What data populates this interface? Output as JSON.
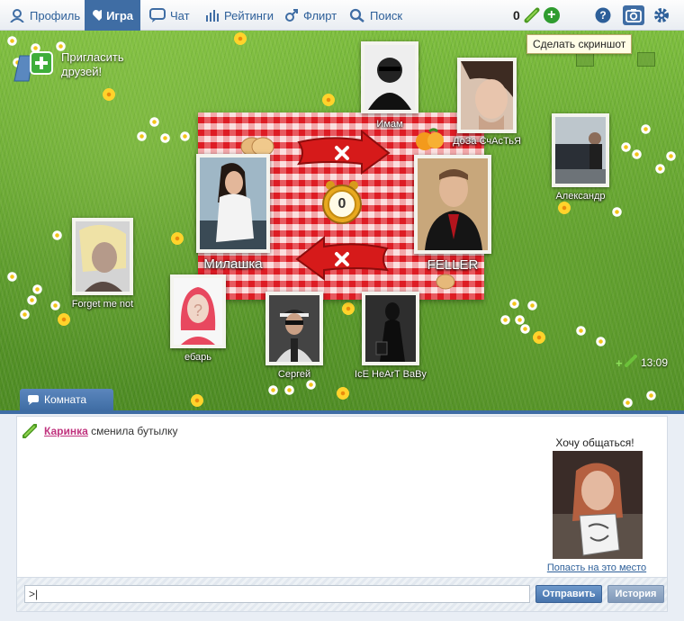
{
  "nav": {
    "items": [
      {
        "id": "profile",
        "label": "Профиль"
      },
      {
        "id": "game",
        "label": "Игра"
      },
      {
        "id": "chat",
        "label": "Чат"
      },
      {
        "id": "ratings",
        "label": "Рейтинги"
      },
      {
        "id": "flirt",
        "label": "Флирт"
      },
      {
        "id": "search",
        "label": "Поиск"
      }
    ],
    "active": "game",
    "coins": "0"
  },
  "tooltip": "Сделать скриншот",
  "invite": "Пригласить друзей!",
  "players": {
    "imam": "Имам",
    "doza": "ДоЗа СчАсТьЯ",
    "alexander": "Александр",
    "milashka": "Милашка",
    "feller": "FELLER",
    "forget": "Forget me not",
    "ebar": "ебарь",
    "sergey": "Сергей",
    "iceheart": "IcE HeArT BaBy"
  },
  "bottle_count": "0",
  "time": "13:09",
  "room_tab": "Комната",
  "chat": {
    "message": {
      "who": "Каринка",
      "text": "сменила бутылку"
    },
    "want_title": "Хочу общаться!",
    "want_link": "Попасть на это место",
    "input_value": ">|",
    "send_label": "Отправить",
    "history_label": "История"
  },
  "colors": {
    "accent": "#3f6da4",
    "nav_text": "#2d5f99",
    "link_pink": "#c0337e"
  }
}
